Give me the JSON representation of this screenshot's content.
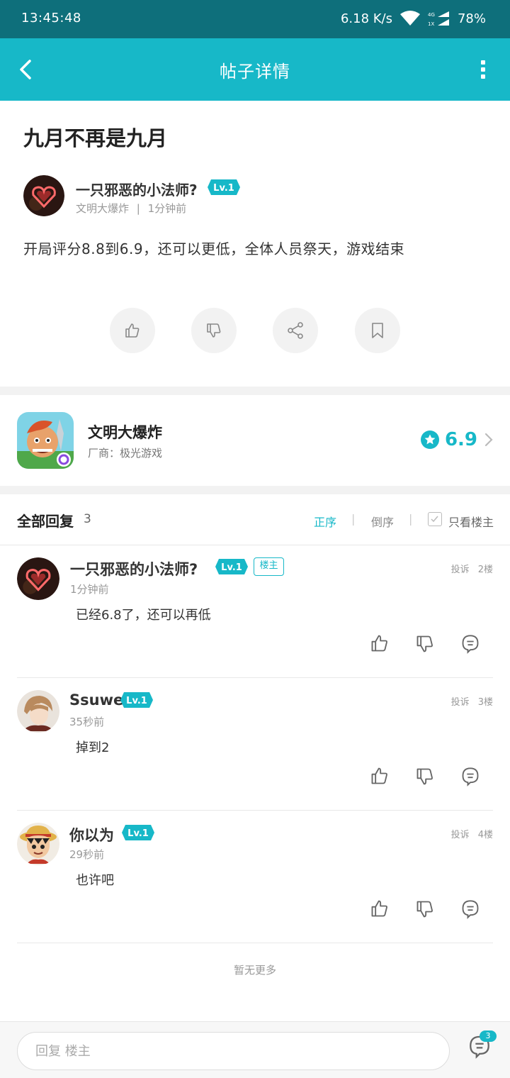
{
  "status_bar": {
    "time": "13:45:48",
    "speed": "6.18 K/s",
    "battery": "78%",
    "network_top": "4G",
    "network_bottom": "1X"
  },
  "app_bar": {
    "title": "帖子详情"
  },
  "post": {
    "title": "九月不再是九月",
    "author": "一只邪恶的小法师?",
    "level": "Lv.1",
    "game": "文明大爆炸",
    "meta_sep": "|",
    "time": "1分钟前",
    "body": "开局评分8.8到6.9，还可以更低，全体人员祭天，游戏结束"
  },
  "game_card": {
    "name": "文明大爆炸",
    "vendor": "厂商：极光游戏",
    "rating": "6.9"
  },
  "replies": {
    "title": "全部回复",
    "count": "3",
    "sort_asc": "正序",
    "sort_desc": "倒序",
    "sep": "|",
    "only_op": "只看楼主",
    "items": [
      {
        "name": "一只邪恶的小法师?",
        "level": "Lv.1",
        "op_badge": "楼主",
        "time": "1分钟前",
        "text": "已经6.8了，还可以再低",
        "report": "投诉",
        "floor": "2楼"
      },
      {
        "name": "Ssuwe",
        "level": "Lv.1",
        "time": "35秒前",
        "text": "掉到2",
        "report": "投诉",
        "floor": "3楼"
      },
      {
        "name": "你以为",
        "level": "Lv.1",
        "time": "29秒前",
        "text": "也许吧",
        "report": "投诉",
        "floor": "4楼"
      }
    ],
    "no_more": "暂无更多"
  },
  "bottom_bar": {
    "placeholder": "回复 楼主",
    "badge_count": "3"
  },
  "colors": {
    "accent": "#17b8c8",
    "status_bar": "#0e6f7b"
  }
}
